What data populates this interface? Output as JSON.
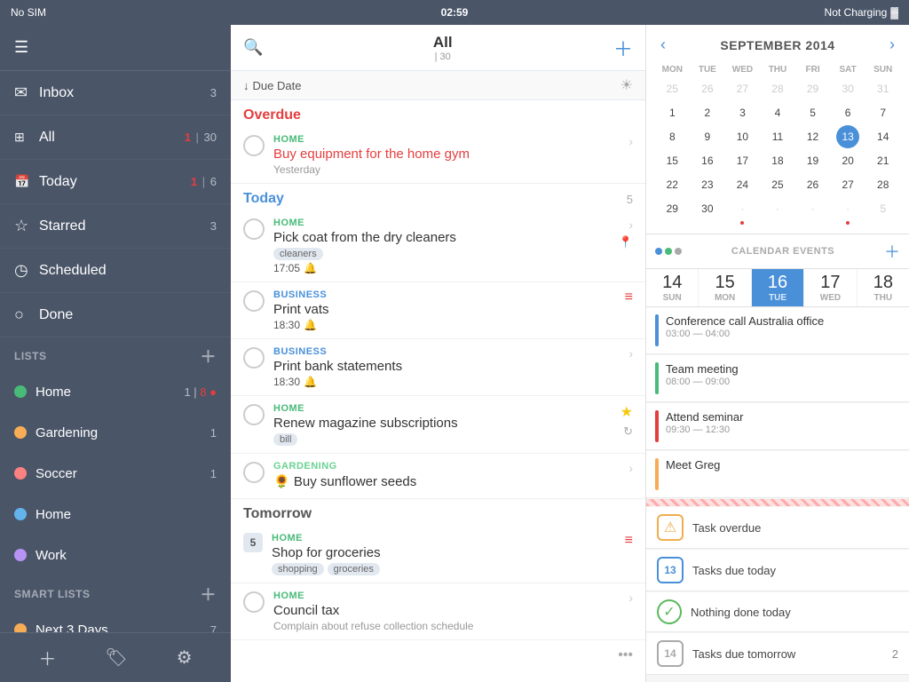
{
  "statusBar": {
    "carrier": "No SIM",
    "time": "02:59",
    "charging": "Not Charging",
    "batteryIcon": "🔋"
  },
  "sidebar": {
    "navItems": [
      {
        "id": "inbox",
        "icon": "✉",
        "label": "Inbox",
        "badge": "3"
      },
      {
        "id": "all",
        "icon": "⊞",
        "label": "All",
        "badge1": "1",
        "sep": "|",
        "badge2": "30"
      },
      {
        "id": "today",
        "icon": "📅",
        "label": "Today",
        "badge1": "1",
        "sep": "|",
        "badge2": "6"
      },
      {
        "id": "starred",
        "icon": "☆",
        "label": "Starred",
        "badge": "3"
      },
      {
        "id": "scheduled",
        "icon": "🕐",
        "label": "Scheduled",
        "badge": ""
      },
      {
        "id": "done",
        "icon": "○",
        "label": "Done",
        "badge": ""
      }
    ],
    "listsHeader": "LISTS",
    "lists": [
      {
        "id": "home1",
        "label": "Home",
        "color": "#48bb78",
        "badge": "1",
        "extra": "8",
        "extraColor": "#e53e3e"
      },
      {
        "id": "gardening",
        "label": "Gardening",
        "color": "#f6ad55",
        "badge": "1",
        "extra": "",
        "extraColor": ""
      },
      {
        "id": "soccer",
        "label": "Soccer",
        "color": "#fc8181",
        "badge": "1",
        "extra": "",
        "extraColor": ""
      },
      {
        "id": "home2",
        "label": "Home",
        "color": "#63b3ed",
        "badge": "",
        "extra": "",
        "extraColor": ""
      },
      {
        "id": "work",
        "label": "Work",
        "color": "#b794f4",
        "badge": "",
        "extra": "",
        "extraColor": ""
      }
    ],
    "smartListsHeader": "SMART LISTS",
    "smartLists": [
      {
        "id": "next3days",
        "label": "Next 3 Days",
        "badge": "7"
      }
    ],
    "footerButtons": [
      "＋",
      "🏷",
      "⚙"
    ]
  },
  "main": {
    "title": "All",
    "titleCount": "| 30",
    "sortLabel": "↓ Due Date",
    "sections": [
      {
        "id": "overdue",
        "title": "Overdue",
        "type": "overdue",
        "count": "",
        "tasks": [
          {
            "id": "t1",
            "category": "HOME",
            "categoryType": "home",
            "name": "Buy equipment for the home gym",
            "nameStyle": "overdue",
            "meta": "Yesterday",
            "tags": [],
            "time": "",
            "hasBell": false,
            "hasLocation": false,
            "hasStar": false,
            "hasRepeat": false,
            "priority": false,
            "numBadge": ""
          }
        ]
      },
      {
        "id": "today",
        "title": "Today",
        "type": "today",
        "count": "5",
        "tasks": [
          {
            "id": "t2",
            "category": "HOME",
            "categoryType": "home",
            "name": "Pick coat from the dry cleaners",
            "nameStyle": "normal",
            "meta": "",
            "tags": [
              "cleaners"
            ],
            "time": "17:05",
            "hasBell": true,
            "hasLocation": true,
            "hasStar": false,
            "hasRepeat": false,
            "priority": false,
            "numBadge": ""
          },
          {
            "id": "t3",
            "category": "BUSINESS",
            "categoryType": "business",
            "name": "Print vats",
            "nameStyle": "normal",
            "meta": "",
            "tags": [],
            "time": "18:30",
            "hasBell": true,
            "hasLocation": false,
            "hasStar": false,
            "hasRepeat": false,
            "priority": true,
            "numBadge": ""
          },
          {
            "id": "t4",
            "category": "BUSINESS",
            "categoryType": "business",
            "name": "Print bank statements",
            "nameStyle": "normal",
            "meta": "",
            "tags": [],
            "time": "18:30",
            "hasBell": true,
            "hasLocation": false,
            "hasStar": false,
            "hasRepeat": false,
            "priority": false,
            "numBadge": ""
          },
          {
            "id": "t5",
            "category": "HOME",
            "categoryType": "home",
            "name": "Renew magazine subscriptions",
            "nameStyle": "normal",
            "meta": "",
            "tags": [
              "bill"
            ],
            "time": "",
            "hasBell": false,
            "hasLocation": false,
            "hasStar": true,
            "hasRepeat": true,
            "priority": false,
            "numBadge": ""
          },
          {
            "id": "t6",
            "category": "GARDENING",
            "categoryType": "gardening",
            "name": "🌻 Buy sunflower seeds",
            "nameStyle": "normal",
            "meta": "",
            "tags": [],
            "time": "",
            "hasBell": false,
            "hasLocation": false,
            "hasStar": false,
            "hasRepeat": false,
            "priority": false,
            "numBadge": ""
          }
        ]
      },
      {
        "id": "tomorrow",
        "title": "Tomorrow",
        "type": "tomorrow",
        "count": "",
        "tasks": [
          {
            "id": "t7",
            "category": "HOME",
            "categoryType": "home",
            "name": "Shop for groceries",
            "nameStyle": "normal",
            "meta": "",
            "tags": [
              "shopping",
              "groceries"
            ],
            "time": "",
            "hasBell": false,
            "hasLocation": false,
            "hasStar": false,
            "hasRepeat": false,
            "priority": true,
            "numBadge": "5"
          },
          {
            "id": "t8",
            "category": "HOME",
            "categoryType": "home",
            "name": "Council tax",
            "nameStyle": "normal",
            "meta": "Complain about refuse collection schedule",
            "tags": [],
            "time": "",
            "hasBell": false,
            "hasLocation": false,
            "hasStar": false,
            "hasRepeat": false,
            "priority": false,
            "numBadge": ""
          }
        ]
      }
    ]
  },
  "calendar": {
    "month": "SEPTEMBER 2014",
    "daysOfWeek": [
      "MON",
      "TUE",
      "WED",
      "THU",
      "FRI",
      "SAT",
      "SUN"
    ],
    "weeks": [
      [
        {
          "day": "25",
          "other": true,
          "today": false,
          "dot": null
        },
        {
          "day": "26",
          "other": true,
          "today": false,
          "dot": null
        },
        {
          "day": "27",
          "other": true,
          "today": false,
          "dot": null
        },
        {
          "day": "28",
          "other": true,
          "today": false,
          "dot": null
        },
        {
          "day": "29",
          "other": true,
          "today": false,
          "dot": null
        },
        {
          "day": "30",
          "other": true,
          "today": false,
          "dot": null
        },
        {
          "day": "31",
          "other": true,
          "today": false,
          "dot": null
        }
      ],
      [
        {
          "day": "1",
          "other": false,
          "today": false,
          "dot": null
        },
        {
          "day": "2",
          "other": false,
          "today": false,
          "dot": null
        },
        {
          "day": "3",
          "other": false,
          "today": false,
          "dot": null
        },
        {
          "day": "4",
          "other": false,
          "today": false,
          "dot": null
        },
        {
          "day": "5",
          "other": false,
          "today": false,
          "dot": null
        },
        {
          "day": "6",
          "other": false,
          "today": false,
          "dot": null
        },
        {
          "day": "7",
          "other": false,
          "today": false,
          "dot": null
        }
      ],
      [
        {
          "day": "8",
          "other": false,
          "today": false,
          "dot": null
        },
        {
          "day": "9",
          "other": false,
          "today": false,
          "dot": null
        },
        {
          "day": "10",
          "other": false,
          "today": false,
          "dot": null
        },
        {
          "day": "11",
          "other": false,
          "today": false,
          "dot": null
        },
        {
          "day": "12",
          "other": false,
          "today": false,
          "dot": null
        },
        {
          "day": "13",
          "other": false,
          "today": true,
          "dot": null
        },
        {
          "day": "14",
          "other": false,
          "today": false,
          "dot": null
        }
      ],
      [
        {
          "day": "15",
          "other": false,
          "today": false,
          "dot": null
        },
        {
          "day": "16",
          "other": false,
          "today": false,
          "dot": null
        },
        {
          "day": "17",
          "other": false,
          "today": false,
          "dot": null
        },
        {
          "day": "18",
          "other": false,
          "today": false,
          "dot": null
        },
        {
          "day": "19",
          "other": false,
          "today": false,
          "dot": null
        },
        {
          "day": "20",
          "other": false,
          "today": false,
          "dot": null
        },
        {
          "day": "21",
          "other": false,
          "today": false,
          "dot": null
        }
      ],
      [
        {
          "day": "22",
          "other": false,
          "today": false,
          "dot": null
        },
        {
          "day": "23",
          "other": false,
          "today": false,
          "dot": null
        },
        {
          "day": "24",
          "other": false,
          "today": false,
          "dot": null
        },
        {
          "day": "25",
          "other": false,
          "today": false,
          "dot": null
        },
        {
          "day": "26",
          "other": false,
          "today": false,
          "dot": null
        },
        {
          "day": "27",
          "other": false,
          "today": false,
          "dot": null
        },
        {
          "day": "28",
          "other": false,
          "today": false,
          "dot": null
        }
      ],
      [
        {
          "day": "29",
          "other": false,
          "today": false,
          "dot": null
        },
        {
          "day": "30",
          "other": false,
          "today": false,
          "dot": null
        },
        {
          "day": "·",
          "other": true,
          "today": false,
          "dot": "red"
        },
        {
          "day": "·",
          "other": true,
          "today": false,
          "dot": null
        },
        {
          "day": "·",
          "other": true,
          "today": false,
          "dot": null
        },
        {
          "day": "·",
          "other": true,
          "today": false,
          "dot": "red"
        },
        {
          "day": "5",
          "other": true,
          "today": false,
          "dot": null
        }
      ]
    ],
    "dayStrip": [
      {
        "num": "14",
        "name": "SUN"
      },
      {
        "num": "15",
        "name": "MON"
      },
      {
        "num": "16",
        "name": "TUE",
        "selected": true
      },
      {
        "num": "17",
        "name": "WED"
      },
      {
        "num": "18",
        "name": "THU"
      }
    ],
    "events": [
      {
        "id": "e1",
        "name": "Conference call Australia office",
        "time": "03:00 — 04:00",
        "barColor": "#4a90d9"
      },
      {
        "id": "e2",
        "name": "Team meeting",
        "time": "08:00 — 09:00",
        "barColor": "#48bb78"
      },
      {
        "id": "e3",
        "name": "Attend seminar",
        "time": "09:30 — 12:30",
        "barColor": "#e53e3e"
      },
      {
        "id": "e4",
        "name": "Meet Greg",
        "time": "",
        "barColor": "#f6ad55"
      }
    ]
  },
  "legend": {
    "items": [
      {
        "id": "leg1",
        "iconType": "overdue",
        "iconLabel": "⚠",
        "label": "Task overdue",
        "count": ""
      },
      {
        "id": "leg2",
        "iconType": "today",
        "iconLabel": "13",
        "label": "Tasks due today",
        "count": ""
      },
      {
        "id": "leg3",
        "iconType": "done",
        "iconLabel": "✓",
        "label": "Nothing done today",
        "count": ""
      },
      {
        "id": "leg4",
        "iconType": "tomorrow",
        "iconLabel": "14",
        "label": "Tasks due tomorrow",
        "count": "2"
      }
    ]
  }
}
